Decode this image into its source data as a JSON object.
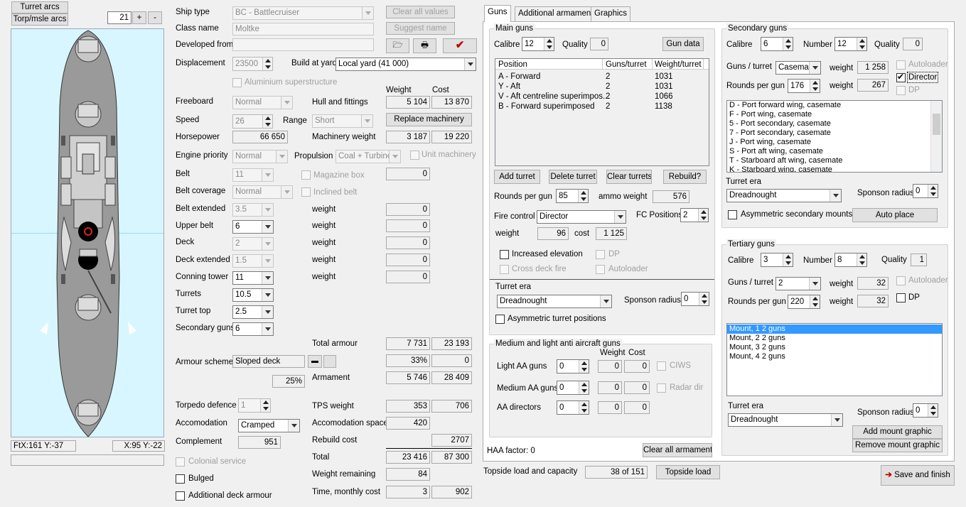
{
  "left": {
    "turret_arcs": "Turret arcs",
    "torp_arcs": "Torp/msle arcs",
    "zoom": "21",
    "plus": "+",
    "minus": "-",
    "coord1": "FtX:161 Y:-37",
    "coord2": "X:95 Y:-22"
  },
  "form": {
    "ship_type_label": "Ship type",
    "ship_type": "BC - Battlecruiser",
    "class_name_label": "Class name",
    "class_name": "Moltke",
    "developed_from_label": "Developed from",
    "developed_from": "",
    "displacement_label": "Displacement",
    "displacement": "23500",
    "build_yard_label": "Build at yard",
    "build_yard": "Local yard (41 000)",
    "aluminium": "Aluminium superstructure",
    "clear_all": "Clear all values",
    "suggest_name": "Suggest name",
    "col_weight": "Weight",
    "col_cost": "Cost",
    "freeboard_label": "Freeboard",
    "freeboard": "Normal",
    "hull_label": "Hull and fittings",
    "hull_weight": "5 104",
    "hull_cost": "13 870",
    "speed_label": "Speed",
    "speed": "26",
    "range_label": "Range",
    "range": "Short",
    "replace_machinery": "Replace machinery",
    "hp_label": "Horsepower",
    "hp": "66 650",
    "mach_label": "Machinery weight",
    "mach_weight": "3 187",
    "mach_cost": "19 220",
    "engine_label": "Engine priority",
    "engine": "Normal",
    "propulsion_label": "Propulsion",
    "propulsion": "Coal + Turbine",
    "unit_machinery": "Unit machinery",
    "belt_label": "Belt",
    "belt": "11",
    "magazine_box": "Magazine box",
    "magazine_val": "0",
    "belt_cov_label": "Belt coverage",
    "belt_cov": "Normal",
    "inclined_belt": "Inclined belt",
    "belt_ext_label": "Belt extended",
    "belt_ext": "3.5",
    "w1_label": "weight",
    "w1": "0",
    "upper_belt_label": "Upper belt",
    "upper_belt": "6",
    "w2_label": "weight",
    "w2": "0",
    "deck_label": "Deck",
    "deck": "2",
    "w3_label": "weight",
    "w3": "0",
    "deck_ext_label": "Deck extended",
    "deck_ext": "1.5",
    "w4_label": "weight",
    "w4": "0",
    "conning_label": "Conning tower",
    "conning": "11",
    "w5_label": "weight",
    "w5": "0",
    "turrets_label": "Turrets",
    "turrets": "10.5",
    "turret_top_label": "Turret top",
    "turret_top": "2.5",
    "sec_guns_label": "Secondary guns",
    "sec_guns": "6",
    "total_armour_label": "Total armour",
    "total_armour_w": "7 731",
    "total_armour_c": "23 193",
    "armour_scheme_label": "Armour scheme",
    "armour_scheme": "Sloped deck",
    "pct1": "33%",
    "pct1b": "0",
    "pct2": "25%",
    "armament_label": "Armament",
    "armament_w": "5 746",
    "armament_c": "28 409",
    "torp_def_label": "Torpedo defence",
    "torp_def": "1",
    "tps_label": "TPS weight",
    "tps_w": "353",
    "tps_c": "706",
    "accom_label": "Accomodation",
    "accom": "Cramped",
    "accom_space_label": "Accomodation space",
    "accom_space": "420",
    "complement_label": "Complement",
    "complement": "951",
    "rebuild_label": "Rebuild cost",
    "rebuild": "2707",
    "total_label": "Total",
    "total_w": "23 416",
    "total_c": "87 300",
    "colonial": "Colonial service",
    "weight_rem_label": "Weight remaining",
    "weight_rem": "84",
    "bulged": "Bulged",
    "time_label": "Time, monthly cost",
    "time": "3",
    "monthly": "902",
    "add_deck": "Additional deck armour"
  },
  "tabs": [
    "Guns",
    "Additional armament",
    "Graphics"
  ],
  "main_guns": {
    "title": "Main guns",
    "calibre_label": "Calibre",
    "calibre": "12",
    "quality_label": "Quality",
    "quality": "0",
    "gun_data": "Gun data",
    "headers": [
      "Position",
      "Guns/turret",
      "Weight/turret"
    ],
    "rows": [
      [
        "A - Forward",
        "2",
        "1031"
      ],
      [
        "Y - Aft",
        "2",
        "1031"
      ],
      [
        "V - Aft centreline superimpos...",
        "2",
        "1066"
      ],
      [
        "B - Forward superimposed",
        "2",
        "1138"
      ]
    ],
    "add_turret": "Add turret",
    "delete_turret": "Delete turret",
    "clear_turrets": "Clear turrets",
    "rebuild": "Rebuild?",
    "rpg_label": "Rounds per gun",
    "rpg": "85",
    "ammo_label": "ammo weight",
    "ammo": "576",
    "fire_label": "Fire control",
    "fire": "Director",
    "fcpos_label": "FC Positions",
    "fcpos": "2",
    "weight_label": "weight",
    "weight": "96",
    "cost_label": "cost",
    "cost": "1 125",
    "inc_elev": "Increased elevation",
    "dp": "DP",
    "cross_deck": "Cross deck fire",
    "autoloader": "Autoloader",
    "era_label": "Turret era",
    "era": "Dreadnought",
    "sponson_label": "Sponson radius",
    "sponson": "0",
    "asym": "Asymmetric turret positions"
  },
  "aa": {
    "title": "Medium and light anti aircraft guns",
    "weight_h": "Weight",
    "cost_h": "Cost",
    "light_label": "Light AA guns",
    "light": "0",
    "light_w": "0",
    "light_c": "0",
    "ciws": "CIWS",
    "med_label": "Medium AA guns",
    "med": "0",
    "med_w": "0",
    "med_c": "0",
    "radar": "Radar dir",
    "dir_label": "AA directors",
    "dir": "0",
    "dir_w": "0",
    "dir_c": "0"
  },
  "haa": "HAA factor: 0",
  "clear_all_arm": "Clear all armament",
  "topside_label": "Topside load and capacity",
  "topside": "38 of 151",
  "topside_btn": "Topside load",
  "secondary": {
    "title": "Secondary guns",
    "calibre_label": "Calibre",
    "calibre": "6",
    "number_label": "Number",
    "number": "12",
    "quality_label": "Quality",
    "quality": "0",
    "gpt_label": "Guns / turret",
    "gpt": "Casemat",
    "w1_label": "weight",
    "w1": "1 258",
    "autoloader": "Autoloader",
    "director": "Director",
    "rpg_label": "Rounds per gun",
    "rpg": "176",
    "w2_label": "weight",
    "w2": "267",
    "dp": "DP",
    "mounts": [
      "D - Port forward wing, casemate",
      "F - Port wing, casemate",
      "5 - Port secondary, casemate",
      "7 - Port secondary, casemate",
      "J - Port wing, casemate",
      "S - Port aft wing, casemate",
      "T - Starboard aft wing, casemate",
      "K - Starboard wing, casemate"
    ],
    "era_label": "Turret era",
    "era": "Dreadnought",
    "sponson_label": "Sponson radius",
    "sponson": "0",
    "asym": "Asymmetric secondary mounts",
    "auto_place": "Auto place"
  },
  "tertiary": {
    "title": "Tertiary guns",
    "calibre_label": "Calibre",
    "calibre": "3",
    "number_label": "Number",
    "number": "8",
    "quality_label": "Quality",
    "quality": "1",
    "gpt_label": "Guns / turret",
    "gpt": "2",
    "w1_label": "weight",
    "w1": "32",
    "autoloader": "Autoloader",
    "rpg_label": "Rounds per gun",
    "rpg": "220",
    "w2_label": "weight",
    "w2": "32",
    "dp": "DP",
    "mounts": [
      "Mount, 1 2 guns",
      "Mount, 2 2 guns",
      "Mount, 3 2 guns",
      "Mount, 4 2 guns"
    ],
    "era_label": "Turret era",
    "era": "Dreadnought",
    "sponson_label": "Sponson radius",
    "sponson": "0",
    "add_graphic": "Add mount graphic",
    "remove_graphic": "Remove mount graphic"
  },
  "save": "Save and finish"
}
